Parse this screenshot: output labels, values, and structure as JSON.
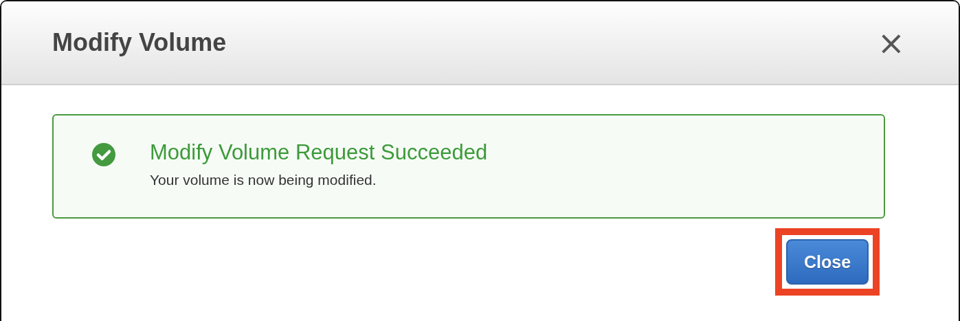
{
  "dialog": {
    "title": "Modify Volume",
    "close_icon": "×"
  },
  "alert": {
    "kind": "success",
    "title": "Modify Volume Request Succeeded",
    "message": "Your volume is now being modified."
  },
  "close_button": {
    "label": "Close",
    "highlighted": true
  }
}
